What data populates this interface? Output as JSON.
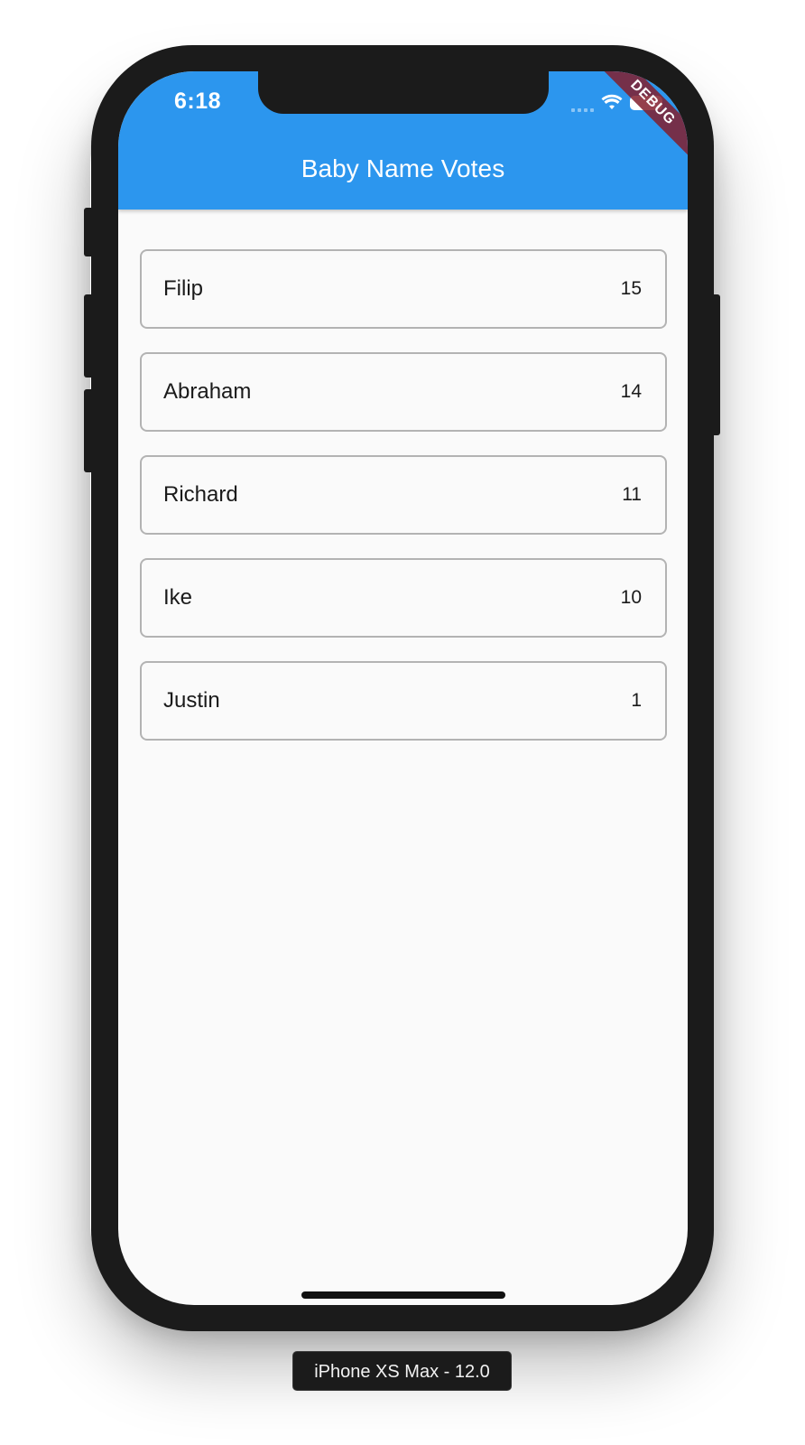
{
  "status_bar": {
    "time": "6:18",
    "icons": [
      "signal-icon",
      "wifi-icon",
      "battery-icon"
    ]
  },
  "debug_banner": "DEBUG",
  "app_bar": {
    "title": "Baby Name Votes",
    "color": "#2c96ee"
  },
  "votes": [
    {
      "name": "Filip",
      "count": "15"
    },
    {
      "name": "Abraham",
      "count": "14"
    },
    {
      "name": "Richard",
      "count": "11"
    },
    {
      "name": "Ike",
      "count": "10"
    },
    {
      "name": "Justin",
      "count": "1"
    }
  ],
  "device_label": "iPhone XS Max - 12.0"
}
